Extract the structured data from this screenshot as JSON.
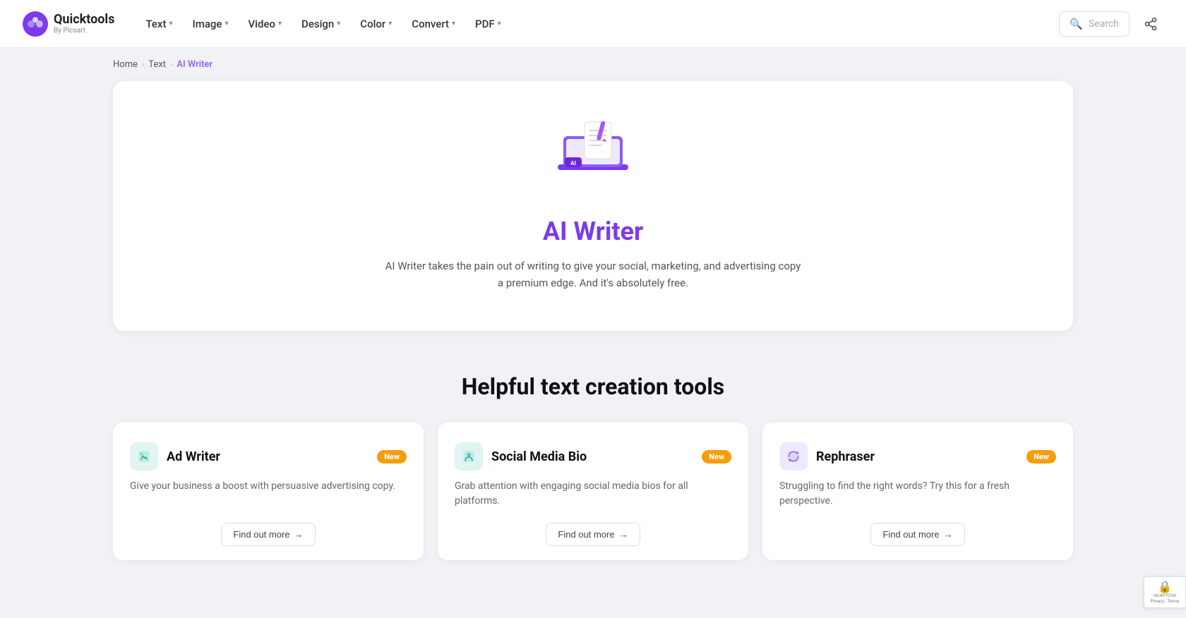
{
  "logo": {
    "quick": "Quicktools",
    "by": "By Picsart"
  },
  "nav": {
    "items": [
      {
        "label": "Text",
        "id": "text"
      },
      {
        "label": "Image",
        "id": "image"
      },
      {
        "label": "Video",
        "id": "video"
      },
      {
        "label": "Design",
        "id": "design"
      },
      {
        "label": "Color",
        "id": "color"
      },
      {
        "label": "Convert",
        "id": "convert"
      },
      {
        "label": "PDF",
        "id": "pdf"
      }
    ]
  },
  "search": {
    "placeholder": "Search"
  },
  "breadcrumb": {
    "home": "Home",
    "text": "Text",
    "current": "AI Writer"
  },
  "hero": {
    "title": "AI Writer",
    "description": "AI Writer takes the pain out of writing to give your social, marketing, and advertising copy a premium edge. And it's absolutely free."
  },
  "tools_section": {
    "title": "Helpful text creation tools",
    "tools": [
      {
        "id": "ad-writer",
        "name": "Ad Writer",
        "badge": "New",
        "description": "Give your business a boost with persuasive advertising copy.",
        "find_out_more": "Find out more",
        "icon_type": "teal"
      },
      {
        "id": "social-media-bio",
        "name": "Social Media Bio",
        "badge": "New",
        "description": "Grab attention with engaging social media bios for all platforms.",
        "find_out_more": "Find out more",
        "icon_type": "teal"
      },
      {
        "id": "rephraser",
        "name": "Rephraser",
        "badge": "New",
        "description": "Struggling to find the right words? Try this for a fresh perspective.",
        "find_out_more": "Find out more",
        "icon_type": "purple"
      }
    ]
  }
}
